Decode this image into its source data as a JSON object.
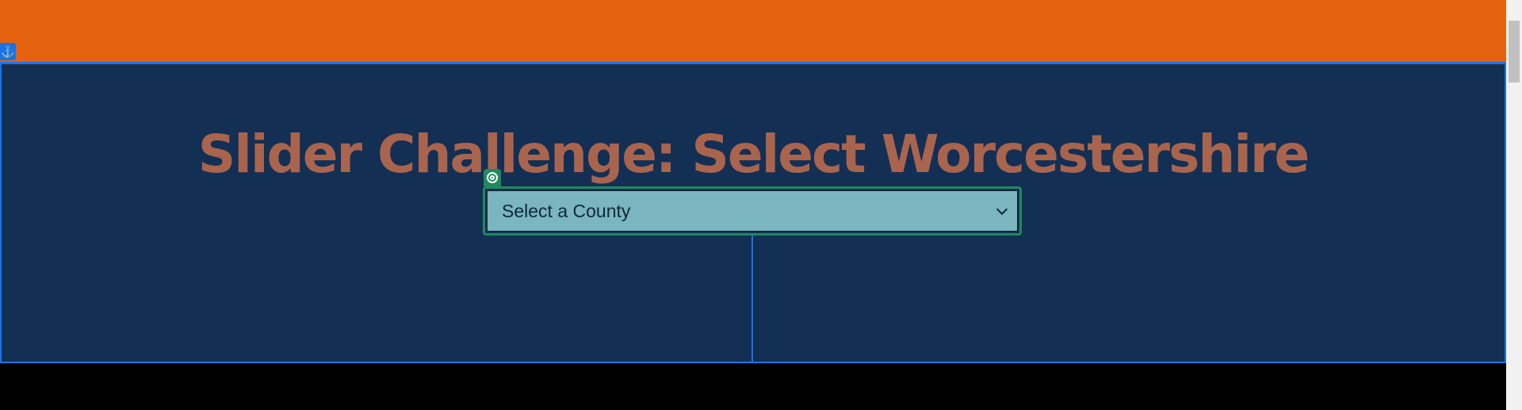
{
  "hero": {
    "title": "Slider Challenge: Select Worcestershire"
  },
  "county_select": {
    "selected_value": "Select a County",
    "icon": "chevron-down-icon"
  },
  "badges": {
    "anchor_icon": "anchor-icon",
    "anchor_glyph": "⚓",
    "target_icon": "target-icon"
  },
  "colors": {
    "top_bar": "#e5630f",
    "hero_background": "#132f54",
    "title_color": "#a9644e",
    "select_background": "#7bb5bf",
    "select_border": "#1f8a5c",
    "bottom_bar": "#000000"
  }
}
